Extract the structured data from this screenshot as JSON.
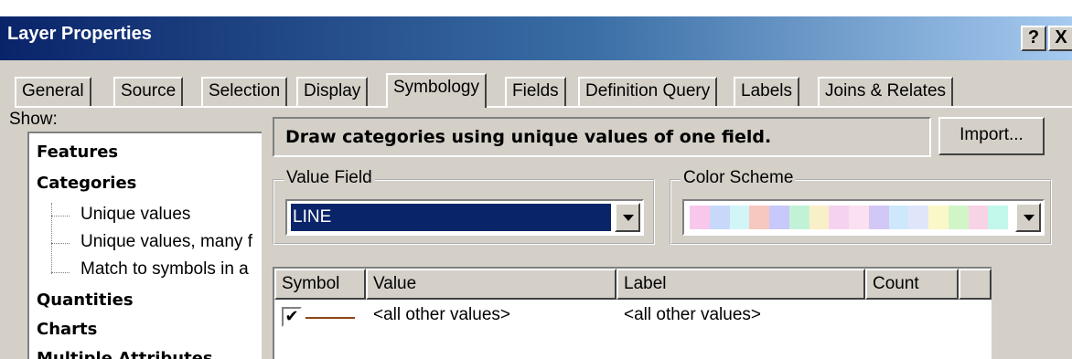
{
  "window": {
    "title": "Layer Properties",
    "help_label": "?",
    "close_label": "X"
  },
  "tabs": [
    {
      "label": "General"
    },
    {
      "label": "Source"
    },
    {
      "label": "Selection"
    },
    {
      "label": "Display"
    },
    {
      "label": "Symbology"
    },
    {
      "label": "Fields"
    },
    {
      "label": "Definition Query"
    },
    {
      "label": "Labels"
    },
    {
      "label": "Joins & Relates"
    }
  ],
  "active_tab": "Symbology",
  "show": {
    "label": "Show:",
    "items": [
      {
        "label": "Features"
      },
      {
        "label": "Categories"
      },
      {
        "label": "Unique values"
      },
      {
        "label": "Unique values, many f"
      },
      {
        "label": "Match to symbols in a"
      },
      {
        "label": "Quantities"
      },
      {
        "label": "Charts"
      },
      {
        "label": "Multiple Attributes"
      }
    ]
  },
  "description": "Draw categories using unique values of one field.",
  "import_label": "Import...",
  "value_field": {
    "label": "Value Field",
    "value": "LINE"
  },
  "color_scheme": {
    "label": "Color Scheme",
    "colors": [
      "#f7c8ec",
      "#c8d8fa",
      "#d2f5f7",
      "#f7c8c0",
      "#c8c8fa",
      "#c2f2d6",
      "#faf0c8",
      "#f5d2f0",
      "#fae0f0",
      "#d2c8f5",
      "#cde8fa",
      "#e0e6fa",
      "#faf8c8",
      "#d2f5c8",
      "#f8d2e6",
      "#c2f7ec"
    ]
  },
  "table": {
    "headers": [
      "Symbol",
      "Value",
      "Label",
      "Count"
    ],
    "rows": [
      {
        "checked": true,
        "value": "<all other values>",
        "label": "<all other values>",
        "count": ""
      }
    ]
  }
}
